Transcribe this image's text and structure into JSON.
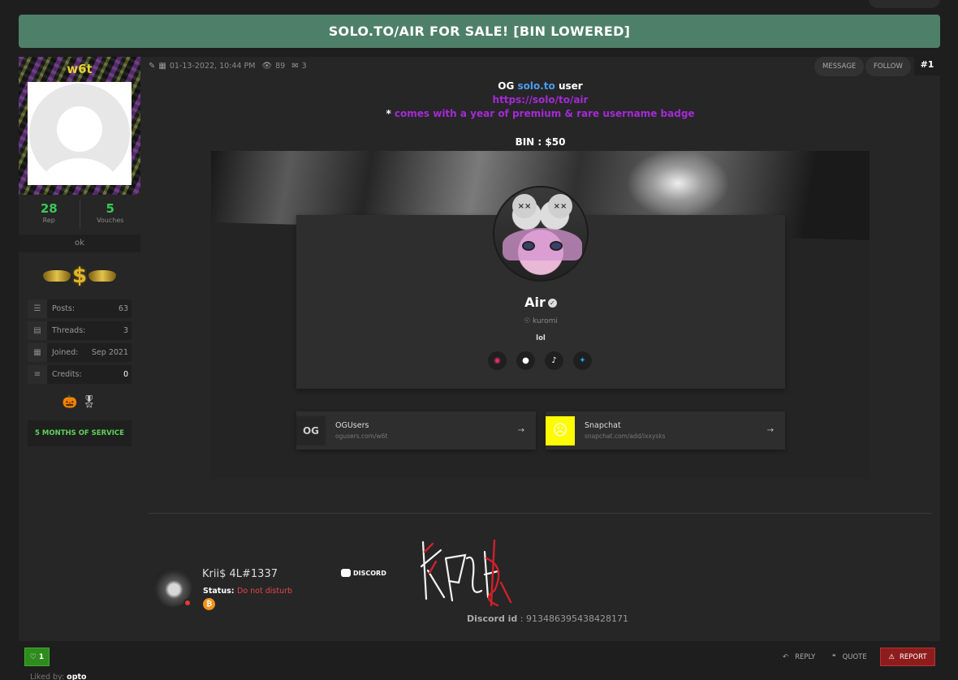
{
  "thread": {
    "title": "SOLO.TO/AIR FOR SALE! [BIN LOWERED]"
  },
  "user": {
    "name": "w6t",
    "rep_value": "28",
    "rep_label": "Rep",
    "vouches_value": "5",
    "vouches_label": "Vouches",
    "usertitle": "ok",
    "stats": [
      {
        "icon": "posts-icon",
        "label": "Posts:",
        "value": "63"
      },
      {
        "icon": "threads-icon",
        "label": "Threads:",
        "value": "3"
      },
      {
        "icon": "calendar-icon",
        "label": "Joined:",
        "value": "Sep 2021"
      },
      {
        "icon": "credits-icon",
        "label": "Credits:",
        "value": "0"
      }
    ],
    "service": "5 MONTHS OF SERVICE"
  },
  "post": {
    "date": "01-13-2022, 10:44 PM",
    "views": "89",
    "replies": "3",
    "message_label": "MESSAGE",
    "follow_label": "FOLLOW",
    "number": "#1",
    "line1_a": "OG ",
    "line1_link": "solo.to",
    "line1_b": " user",
    "line2": "https://solo/to/air",
    "line3_bullet": "* ",
    "line3": "comes with a year of premium & rare username badge",
    "bin": "BIN : $50"
  },
  "profile_card": {
    "name": "Air",
    "location": "kuromi",
    "bio": "lol",
    "socials": [
      "instagram-icon",
      "github-icon",
      "tiktok-icon",
      "twitter-icon"
    ],
    "links": [
      {
        "icon_text": "OG",
        "title": "OGUsers",
        "sub": "ogusers.com/w6t"
      },
      {
        "icon_text": "SC",
        "title": "Snapchat",
        "sub": "snapchat.com/add/ixxysks"
      }
    ]
  },
  "signature": {
    "name": "Krii$ 4L#1337",
    "status_label": "Status:",
    "status_value": "Do not disturb",
    "discord_logo": "DISCORD",
    "discord_id_label": "Discord id",
    "discord_id_value": " : 913486395438428171"
  },
  "footer": {
    "like_count": "1",
    "reply_label": "REPLY",
    "quote_label": "QUOTE",
    "report_label": "REPORT",
    "liked_by_label": "Liked by: ",
    "liked_by_user": "opto"
  },
  "colors": {
    "title_bar": "#4e8069",
    "rep": "#37c85a",
    "purple": "#a42ad6",
    "link_blue": "#4a9cf0",
    "status_dnd": "#e5464a",
    "report": "#8e1c1c"
  }
}
